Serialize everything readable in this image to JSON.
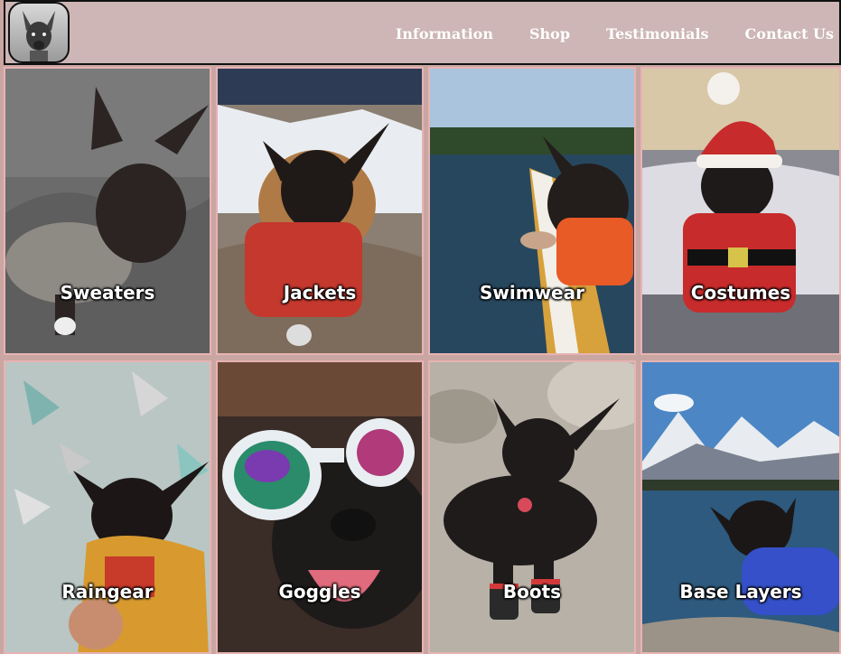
{
  "nav": {
    "items": [
      "Information",
      "Shop",
      "Testimonials",
      "Contact Us"
    ]
  },
  "logo": {
    "icon": "dog-portrait-icon"
  },
  "categories": [
    {
      "label": "Sweaters",
      "bg": "#6b6b6b",
      "accent": "#8e8a84"
    },
    {
      "label": "Jackets",
      "bg": "#9aa7b0",
      "accent": "#c4382e"
    },
    {
      "label": "Swimwear",
      "bg": "#3f6b86",
      "accent": "#e85a26"
    },
    {
      "label": "Costumes",
      "bg": "#8b8b93",
      "accent": "#c82b2b"
    },
    {
      "label": "Raingear",
      "bg": "#b9c6c4",
      "accent": "#d89a2f"
    },
    {
      "label": "Goggles",
      "bg": "#3a2c26",
      "accent": "#e9eef2"
    },
    {
      "label": "Boots",
      "bg": "#b7b1a7",
      "accent": "#d23a3a"
    },
    {
      "label": "Base Layers",
      "bg": "#4d86c4",
      "accent": "#3550c8"
    }
  ]
}
